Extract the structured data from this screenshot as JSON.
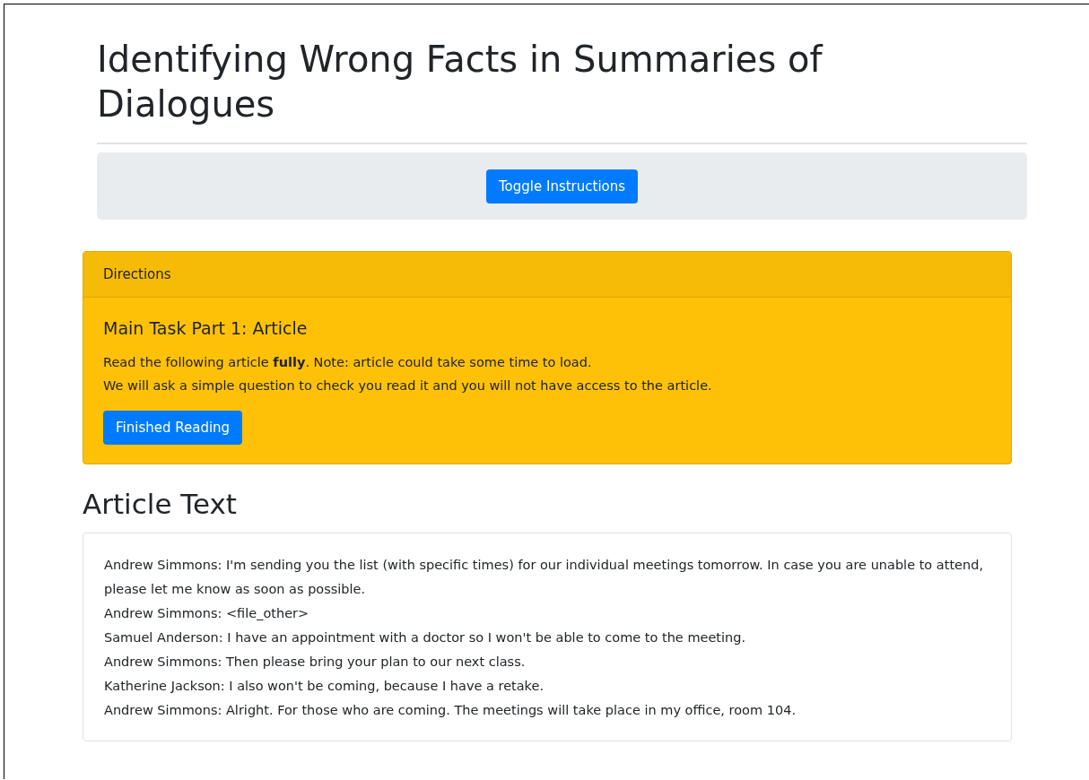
{
  "title": "Identifying Wrong Facts in Summaries of Dialogues",
  "toggle_button": "Toggle Instructions",
  "directions": {
    "header": "Directions",
    "heading": "Main Task Part 1: Article",
    "lines": [
      "Read the following article **fully**. Note: article could take some time to load.",
      "We will ask a simple question to check you read it and you will not have access to the article."
    ],
    "button": "Finished Reading"
  },
  "article": {
    "heading": "Article Text",
    "lines": [
      "Andrew Simmons: I'm sending you the list (with specific times) for our individual meetings tomorrow. In case you are unable to attend, please let me know as soon as possible.",
      "Andrew Simmons: <file_other>",
      "Samuel Anderson: I have an appointment with a doctor so I won't be able to come to the meeting.",
      "Andrew Simmons: Then please bring your plan to our next class.",
      "Katherine Jackson: I also won't be coming, because I have a retake.",
      "Andrew Simmons: Alright. For those who are coming. The meetings will take place in my office, room 104."
    ]
  }
}
